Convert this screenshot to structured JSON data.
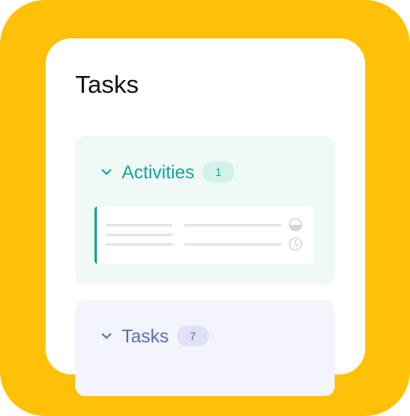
{
  "page": {
    "title": "Tasks"
  },
  "sections": [
    {
      "label": "Activities",
      "count": "1",
      "expanded": true,
      "color": "#14A39C",
      "bg": "#EFF9F6"
    },
    {
      "label": "Tasks",
      "count": "7",
      "expanded": true,
      "color": "#5C6BC0",
      "bg": "#F3F4FC"
    }
  ],
  "activity_item": {
    "icons": [
      "half-circle-status-icon",
      "clock-icon"
    ]
  },
  "colors": {
    "frame": "#FFC107",
    "card": "#FFFFFF",
    "placeholder_line": "#E2E4E6"
  }
}
